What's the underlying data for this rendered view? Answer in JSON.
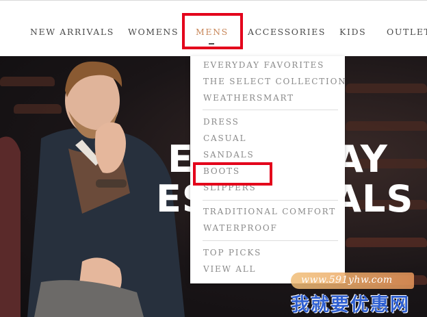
{
  "nav": {
    "items": [
      {
        "label": "NEW ARRIVALS"
      },
      {
        "label": "WOMENS"
      },
      {
        "label": "MENS"
      },
      {
        "label": "ACCESSORIES"
      },
      {
        "label": "KIDS"
      },
      {
        "label": "OUTLET"
      }
    ],
    "active_color": "#c8875a"
  },
  "hero": {
    "line1": "EVERYDAY",
    "line2": "ESSENTIALS"
  },
  "dropdown": {
    "group1": [
      "EVERYDAY FAVORITES",
      "THE SELECT COLLECTION",
      "WEATHERSMART"
    ],
    "group2": [
      "DRESS",
      "CASUAL",
      "SANDALS",
      "BOOTS",
      "SLIPPERS"
    ],
    "group3": [
      "TRADITIONAL COMFORT",
      "WATERPROOF"
    ],
    "group4": [
      "TOP PICKS",
      "VIEW ALL"
    ]
  },
  "watermark": {
    "url": "www.591yhw.com",
    "brand": "我就要优惠网"
  },
  "colors": {
    "highlight": "#e3001b"
  }
}
